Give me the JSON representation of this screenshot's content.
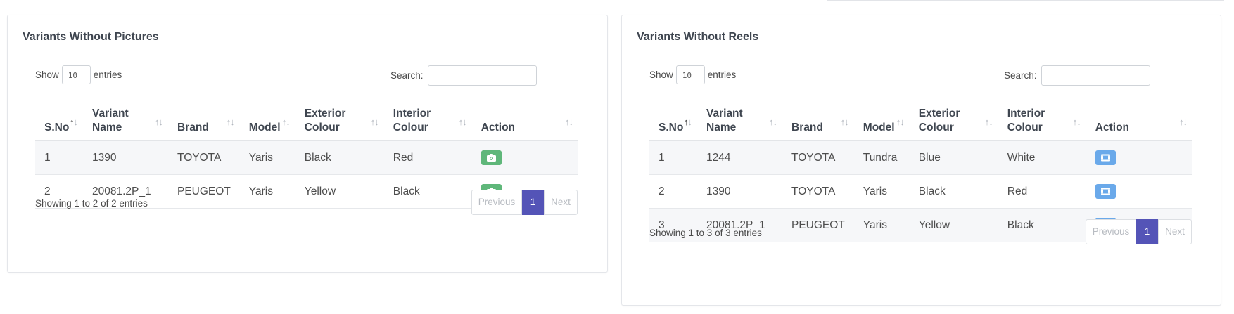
{
  "left": {
    "title": "Variants Without Pictures",
    "show_label": "Show",
    "entries_value": "10",
    "entries_label": "entries",
    "search_label": "Search:",
    "columns": [
      "S.No",
      "Variant Name",
      "Brand",
      "Model",
      "Exterior Colour",
      "Interior Colour",
      "Action"
    ],
    "rows": [
      {
        "sno": "1",
        "variant": "1390",
        "brand": "TOYOTA",
        "model": "Yaris",
        "exterior": "Black",
        "interior": "Red",
        "action_icon": "camera-icon"
      },
      {
        "sno": "2",
        "variant": "20081.2P_1",
        "brand": "PEUGEOT",
        "model": "Yaris",
        "exterior": "Yellow",
        "interior": "Black",
        "action_icon": "camera-icon"
      }
    ],
    "info": "Showing 1 to 2 of 2 entries",
    "prev_label": "Previous",
    "page": "1",
    "next_label": "Next",
    "action_color": "#5fb77a"
  },
  "right": {
    "title": "Variants Without Reels",
    "show_label": "Show",
    "entries_value": "10",
    "entries_label": "entries",
    "search_label": "Search:",
    "columns": [
      "S.No",
      "Variant Name",
      "Brand",
      "Model",
      "Exterior Colour",
      "Interior Colour",
      "Action"
    ],
    "rows": [
      {
        "sno": "1",
        "variant": "1244",
        "brand": "TOYOTA",
        "model": "Tundra",
        "exterior": "Blue",
        "interior": "White",
        "action_icon": "film-icon"
      },
      {
        "sno": "2",
        "variant": "1390",
        "brand": "TOYOTA",
        "model": "Yaris",
        "exterior": "Black",
        "interior": "Red",
        "action_icon": "film-icon"
      },
      {
        "sno": "3",
        "variant": "20081.2P_1",
        "brand": "PEUGEOT",
        "model": "Yaris",
        "exterior": "Yellow",
        "interior": "Black",
        "action_icon": "film-icon"
      }
    ],
    "info": "Showing 1 to 3 of 3 entries",
    "prev_label": "Previous",
    "page": "1",
    "next_label": "Next",
    "action_color": "#6aa9ea"
  },
  "colors": {
    "pager_active": "#5454b7",
    "row_stripe": "#f6f7f9"
  }
}
